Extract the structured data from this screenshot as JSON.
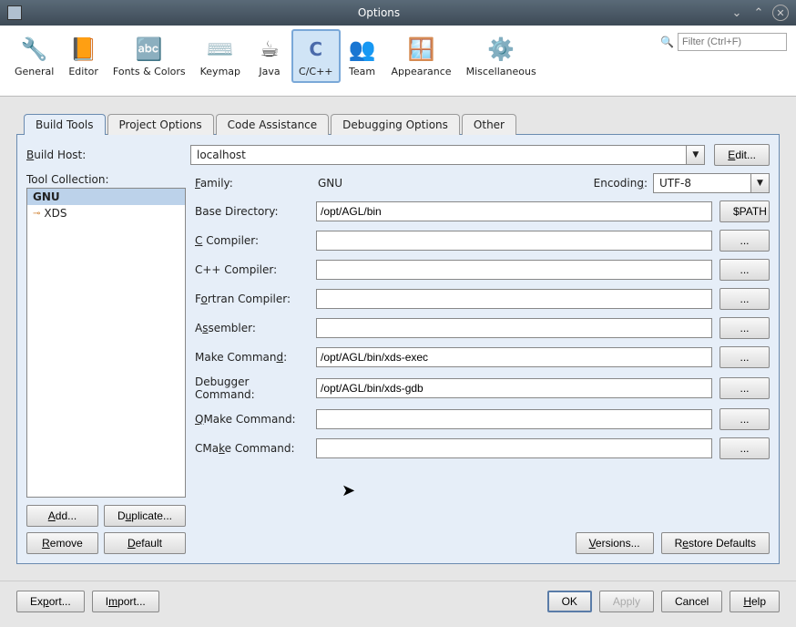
{
  "title": "Options",
  "search_placeholder": "Filter (Ctrl+F)",
  "toolbar_items": [
    {
      "label": "General"
    },
    {
      "label": "Editor"
    },
    {
      "label": "Fonts & Colors"
    },
    {
      "label": "Keymap"
    },
    {
      "label": "Java"
    },
    {
      "label": "C/C++"
    },
    {
      "label": "Team"
    },
    {
      "label": "Appearance"
    },
    {
      "label": "Miscellaneous"
    }
  ],
  "tabs": {
    "build_tools": "Build Tools",
    "project_options": "Project Options",
    "code_assistance": "Code Assistance",
    "debugging_options": "Debugging Options",
    "other": "Other"
  },
  "labels": {
    "build_host": "Build Host:",
    "tool_collection": "Tool Collection:",
    "family": "Family:",
    "encoding": "Encoding:",
    "base_directory": "Base Directory:",
    "c_compiler": "C Compiler:",
    "cpp_compiler": "C++ Compiler:",
    "fortran": "Fortran Compiler:",
    "assembler": "Assembler:",
    "make": "Make Command:",
    "debugger": "Debugger Command:",
    "qmake": "QMake Command:",
    "cmake": "CMake Command:"
  },
  "values": {
    "build_host": "localhost",
    "family": "GNU",
    "encoding": "UTF-8",
    "base_directory": "/opt/AGL/bin",
    "c_compiler": "",
    "cpp_compiler": "",
    "fortran": "",
    "assembler": "",
    "make": "/opt/AGL/bin/xds-exec",
    "debugger": "/opt/AGL/bin/xds-gdb",
    "qmake": "",
    "cmake": ""
  },
  "tool_collection": [
    {
      "name": "GNU"
    },
    {
      "name": "XDS"
    }
  ],
  "buttons": {
    "edit": "Edit...",
    "path": "$PATH",
    "dots": "...",
    "add": "Add...",
    "duplicate": "Duplicate...",
    "remove": "Remove",
    "default": "Default",
    "versions": "Versions...",
    "restore": "Restore Defaults",
    "export": "Export...",
    "import": "Import...",
    "ok": "OK",
    "apply": "Apply",
    "cancel": "Cancel",
    "help": "Help"
  }
}
